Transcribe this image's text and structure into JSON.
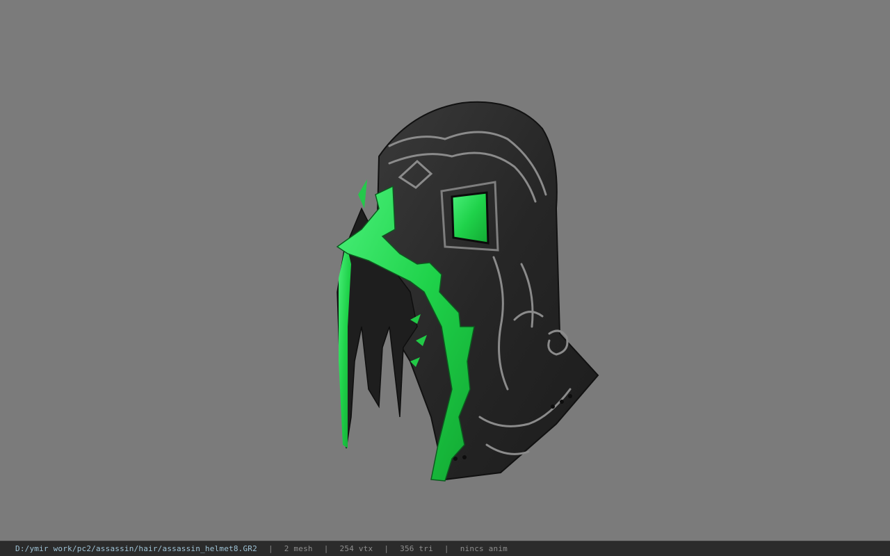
{
  "viewer": {
    "background_color": "#7b7b7b",
    "model_name": "assassin_helmet8",
    "model_colors": {
      "dark_metal": "#2a2a2a",
      "engraving": "#8a8a8a",
      "accent_green": "#22d64a"
    }
  },
  "status": {
    "file_path": "D:/ymir work/pc2/assassin/hair/assassin_helmet8.GR2",
    "separator": "|",
    "mesh_count": "2 mesh",
    "vertex_count": "254 vtx",
    "triangle_count": "356 tri",
    "anim_status": "nincs anim"
  }
}
